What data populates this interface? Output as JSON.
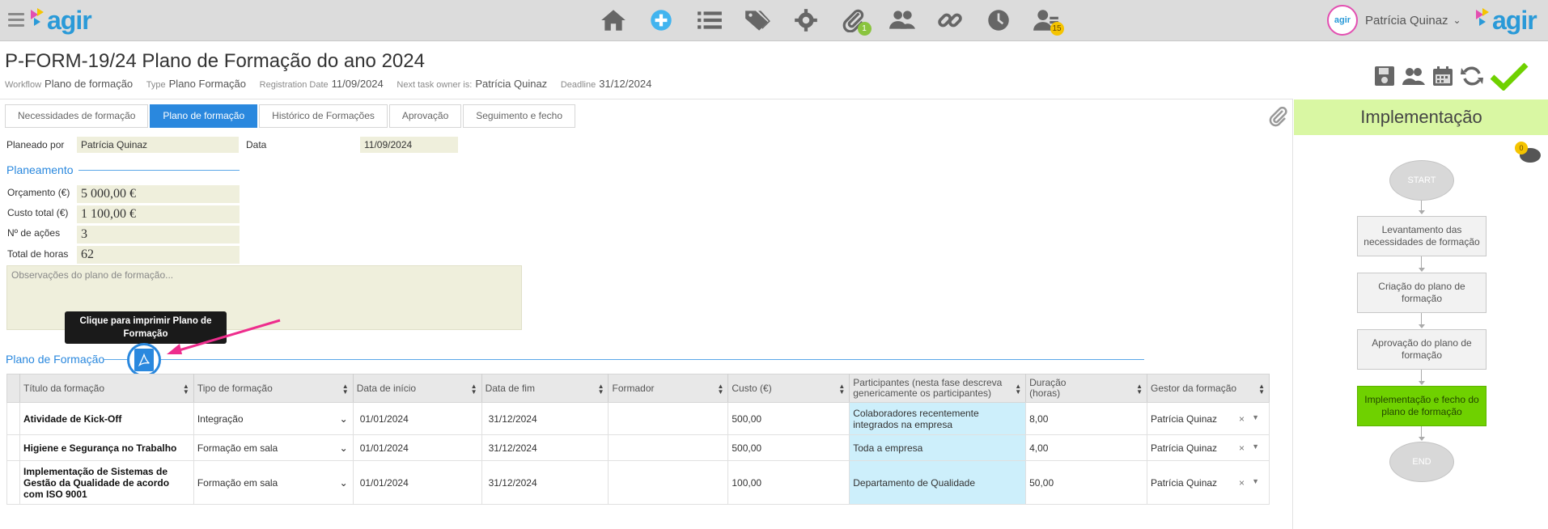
{
  "app": {
    "logo_text": "agir",
    "user_name": "Patrícia Quinaz",
    "avatar_text": "agir"
  },
  "nav": {
    "items": [
      {
        "icon": "home-icon"
      },
      {
        "icon": "plus-circle-icon"
      },
      {
        "icon": "list-icon"
      },
      {
        "icon": "tags-icon"
      },
      {
        "icon": "gear-icon"
      },
      {
        "icon": "paperclip-icon",
        "badge": "1"
      },
      {
        "icon": "users-icon"
      },
      {
        "icon": "link-icon"
      },
      {
        "icon": "clock-icon"
      },
      {
        "icon": "user-clock-icon",
        "badge": "15"
      }
    ]
  },
  "header": {
    "title": "P-FORM-19/24 Plano de Formação do ano 2024",
    "workflow_label": "Workflow",
    "workflow_value": "Plano de formação",
    "type_label": "Type",
    "type_value": "Plano Formação",
    "regdate_label": "Registration Date",
    "regdate_value": "11/09/2024",
    "owner_label": "Next task owner is:",
    "owner_value": "Patrícia Quinaz",
    "deadline_label": "Deadline",
    "deadline_value": "31/12/2024"
  },
  "tabs": [
    {
      "label": "Necessidades de formação"
    },
    {
      "label": "Plano de formação"
    },
    {
      "label": "Histórico de Formações"
    },
    {
      "label": "Aprovação"
    },
    {
      "label": "Seguimento e fecho"
    }
  ],
  "form": {
    "planned_by_label": "Planeado por",
    "planned_by_value": "Patrícia Quinaz",
    "date_label": "Data",
    "date_value": "11/09/2024",
    "planning_title": "Planeamento",
    "budget_label": "Orçamento (€)",
    "budget_value": "5 000,00 €",
    "total_cost_label": "Custo total (€)",
    "total_cost_value": "1 100,00 €",
    "actions_label": "Nº de ações",
    "actions_value": "3",
    "hours_label": "Total de horas",
    "hours_value": "62",
    "notes_placeholder": "Observações do plano de formação...",
    "tooltip_line1": "Clique para imprimir Plano de",
    "tooltip_line2": "Formação",
    "plan_title": "Plano de Formação"
  },
  "table": {
    "headers": [
      "Título da formação",
      "Tipo de formação",
      "Data de início",
      "Data de fim",
      "Formador",
      "Custo (€)",
      "Participantes (nesta fase descreva genericamente os participantes)",
      "Duração (horas)",
      "Gestor da formação"
    ],
    "rows": [
      {
        "title": "Atividade de Kick-Off",
        "type": "Integração",
        "start": "01/01/2024",
        "end": "31/12/2024",
        "trainer": "",
        "cost": "500,00",
        "participants": "Colaboradores recentemente integrados na empresa",
        "duration": "8,00",
        "manager": "Patrícia Quinaz"
      },
      {
        "title": "Higiene e Segurança no Trabalho",
        "type": "Formação em sala",
        "start": "01/01/2024",
        "end": "31/12/2024",
        "trainer": "",
        "cost": "500,00",
        "participants": "Toda a empresa",
        "duration": "4,00",
        "manager": "Patrícia Quinaz"
      },
      {
        "title": "Implementação de Sistemas de Gestão da Qualidade de acordo com ISO 9001",
        "type": "Formação em sala",
        "start": "01/01/2024",
        "end": "31/12/2024",
        "trainer": "",
        "cost": "100,00",
        "participants": "Departamento de Qualidade",
        "duration": "50,00",
        "manager": "Patrícia Quinaz"
      }
    ]
  },
  "workflow": {
    "title": "Implementação",
    "comment_count": "0",
    "start": "START",
    "end": "END",
    "steps": [
      {
        "label": "Levantamento das necessidades de formação"
      },
      {
        "label": "Criação do plano de formação"
      },
      {
        "label": "Aprovação do plano de formação"
      },
      {
        "label": "Implementação e fecho do plano de formação",
        "current": true
      }
    ]
  },
  "colors": {
    "accent": "#2a88de",
    "brand": "#2a9ad8",
    "current_step": "#6fd100",
    "highlight": "#cdeffb",
    "field_bg": "#efefdc"
  }
}
